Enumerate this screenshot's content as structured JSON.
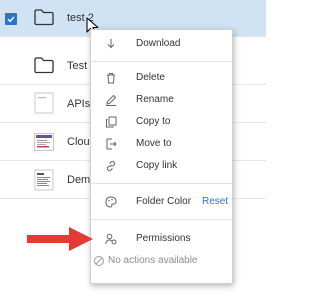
{
  "files": [
    {
      "name": "test 2",
      "selected": true,
      "kind": "folder-icon"
    },
    {
      "name": "Test",
      "selected": false,
      "kind": "folder-icon"
    },
    {
      "name": "APIs",
      "selected": false,
      "kind": "document-thumbnail"
    },
    {
      "name": "Cloud",
      "selected": false,
      "kind": "presentation-thumbnail"
    },
    {
      "name": "Demo",
      "selected": false,
      "kind": "text-thumbnail"
    }
  ],
  "context_menu": {
    "download": "Download",
    "delete": "Delete",
    "rename": "Rename",
    "copy_to": "Copy to",
    "move_to": "Move to",
    "copy_link": "Copy link",
    "folder_color": "Folder Color",
    "reset": "Reset",
    "permissions": "Permissions",
    "no_actions": "No actions available"
  },
  "colors": {
    "selected_row": "#cfe3f5",
    "accent": "#2b75c2",
    "arrow": "#e53935"
  }
}
